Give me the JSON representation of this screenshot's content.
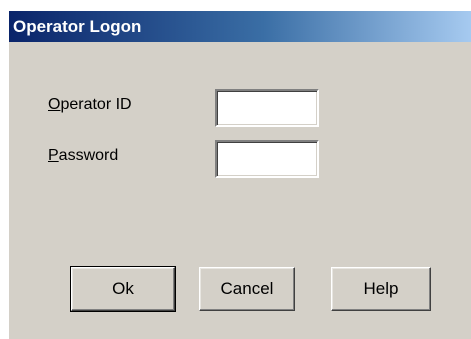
{
  "window": {
    "title": "Operator Logon"
  },
  "form": {
    "operator_id_label_mnemonic": "O",
    "operator_id_label_rest": "perator ID",
    "operator_id_value": "",
    "password_label_mnemonic": "P",
    "password_label_rest": "assword",
    "password_value": ""
  },
  "buttons": {
    "ok_label": "Ok",
    "cancel_label": "Cancel",
    "help_label": "Help"
  }
}
